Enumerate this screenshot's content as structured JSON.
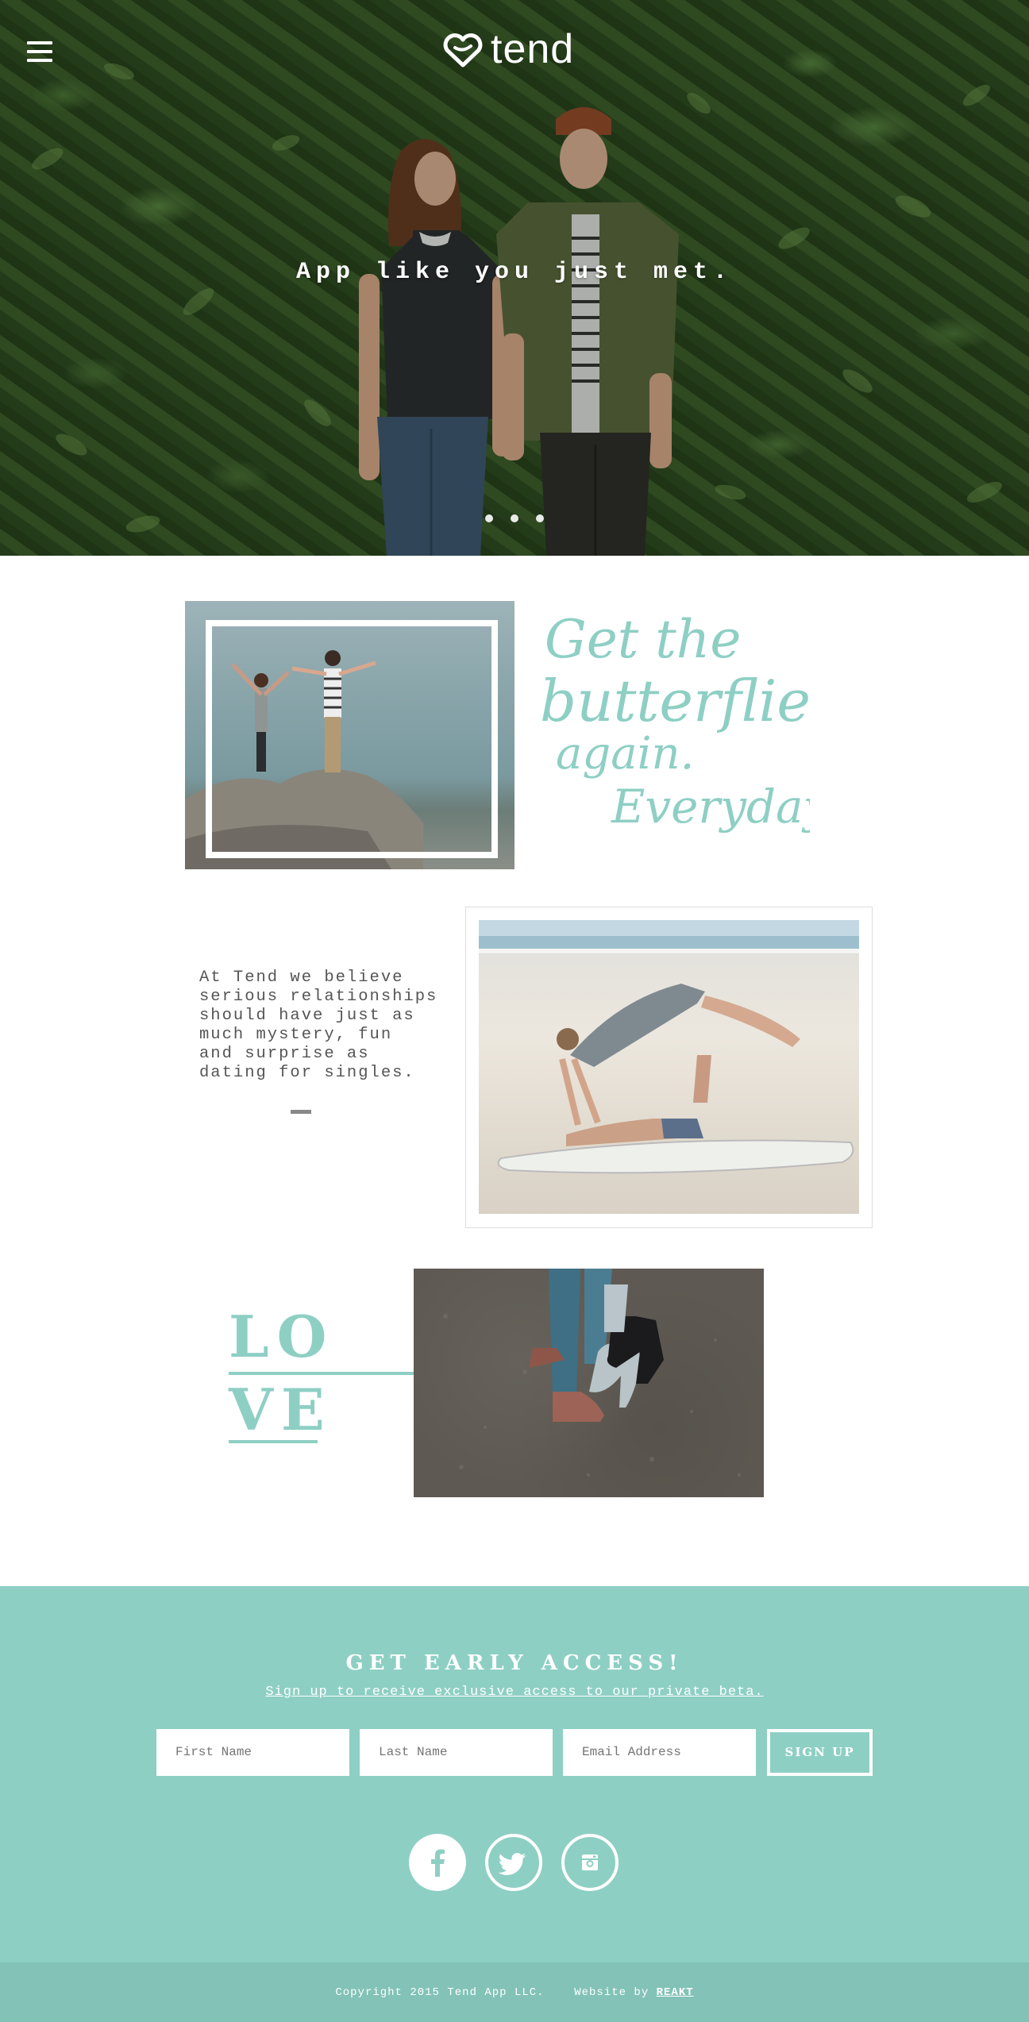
{
  "brand": {
    "name": "tend",
    "accent": "#8ecfc4",
    "footer_color": "#82c2b7"
  },
  "hero": {
    "tagline": "App like you just met.",
    "slide_count": 3
  },
  "section_butterflies": {
    "script_lines": [
      "Get the",
      "butterflies",
      "again.",
      "Everyday."
    ]
  },
  "section_about": {
    "text": "At Tend we believe\nserious relationships\nshould have just as\nmuch mystery, fun\nand surprise as\ndating for singles."
  },
  "section_love": {
    "line1": "LO",
    "line2": "VE"
  },
  "signup": {
    "title": "GET EARLY ACCESS!",
    "subtitle": "Sign up to receive exclusive access to our private beta.",
    "first_name_placeholder": "First Name",
    "last_name_placeholder": "Last Name",
    "email_placeholder": "Email Address",
    "button_label": "SIGN UP"
  },
  "social": [
    {
      "name": "facebook-icon"
    },
    {
      "name": "twitter-icon"
    },
    {
      "name": "instagram-icon"
    }
  ],
  "footer": {
    "copyright": "Copyright 2015 Tend App LLC.",
    "credit_prefix": "Website by",
    "credit_link": "REAKT"
  }
}
